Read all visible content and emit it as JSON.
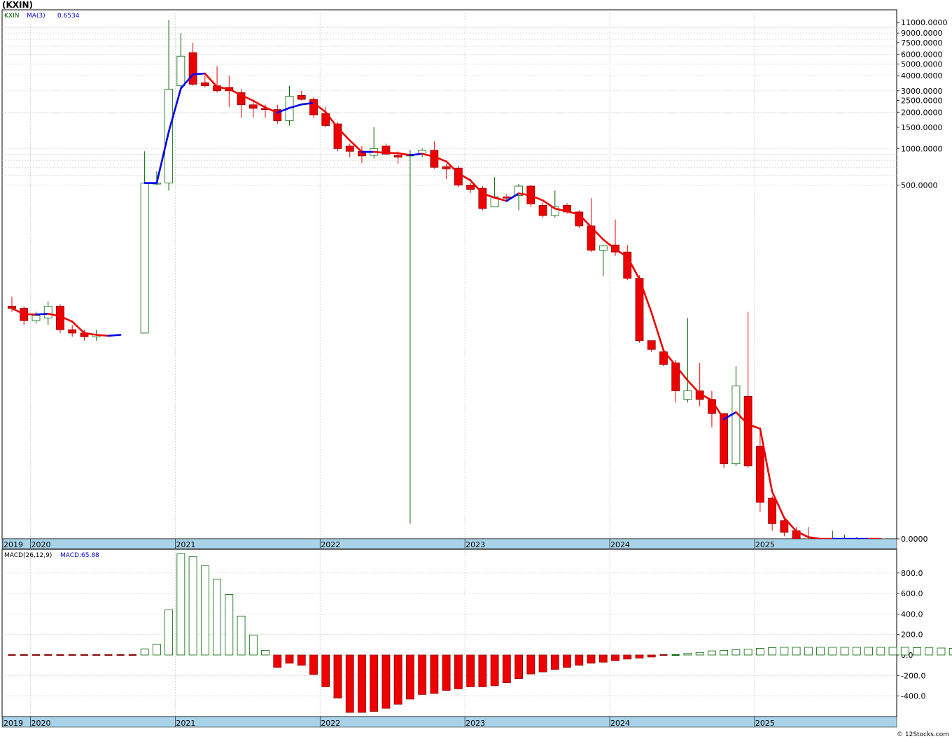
{
  "page": {
    "title": "(KXIN)",
    "footer": "© 12Stocks.com"
  },
  "colors": {
    "grid": "#c8c8c8",
    "axis_strip": "#a9d3e8",
    "up": "#006400",
    "down": "#ee0000",
    "ma_up": "#0000ee",
    "ma_down": "#ee0000"
  },
  "chart_data": [
    {
      "type": "candlestick",
      "panel": "price",
      "scale": "log",
      "legend": {
        "symbol": "KXIN",
        "ma_label": "MA(3)",
        "ma_value": "0.6534"
      },
      "y_tick_labels": [
        "11000.0000",
        "9000.0000",
        "7500.0000",
        "6000.0000",
        "5000.0000",
        "4000.0000",
        "3000.0000",
        "2500.0000",
        "2000.0000",
        "1500.0000",
        "1000.0000",
        "500.0000",
        "0.0000"
      ],
      "y_tick_values": [
        11000,
        9000,
        7500,
        6000,
        5000,
        4000,
        3000,
        2500,
        2000,
        1500,
        1000,
        500,
        0
      ],
      "x_labels": [
        "2019",
        "2020",
        "2021",
        "2022",
        "2023",
        "2024",
        "2025"
      ],
      "candles": [
        {
          "date": "2019-11",
          "o": 50,
          "h": 60,
          "l": 45,
          "c": 48
        },
        {
          "date": "2019-12",
          "o": 48,
          "h": 50,
          "l": 35,
          "c": 38
        },
        {
          "date": "2020-01",
          "o": 38,
          "h": 45,
          "l": 36,
          "c": 42
        },
        {
          "date": "2020-02",
          "o": 40,
          "h": 55,
          "l": 35,
          "c": 50
        },
        {
          "date": "2020-03",
          "o": 50,
          "h": 52,
          "l": 30,
          "c": 32
        },
        {
          "date": "2020-04",
          "o": 32,
          "h": 35,
          "l": 28,
          "c": 30
        },
        {
          "date": "2020-05",
          "o": 30,
          "h": 32,
          "l": 26,
          "c": 28
        },
        {
          "date": "2020-06",
          "o": 28,
          "h": 32,
          "l": 26,
          "c": 29
        },
        {
          "date": "2020-07",
          "o": null,
          "h": null,
          "l": null,
          "c": null
        },
        {
          "date": "2020-08",
          "o": null,
          "h": null,
          "l": null,
          "c": null
        },
        {
          "date": "2020-09",
          "o": null,
          "h": null,
          "l": null,
          "c": null
        },
        {
          "date": "2020-10",
          "o": 30,
          "h": 950,
          "l": 30,
          "c": 520
        },
        {
          "date": "2020-11",
          "o": 520,
          "h": 650,
          "l": 500,
          "c": 520
        },
        {
          "date": "2020-12",
          "o": 520,
          "h": 11500,
          "l": 450,
          "c": 3100
        },
        {
          "date": "2021-01",
          "o": 3300,
          "h": 9000,
          "l": 3100,
          "c": 5800
        },
        {
          "date": "2021-02",
          "o": 6200,
          "h": 7500,
          "l": 3300,
          "c": 3400
        },
        {
          "date": "2021-03",
          "o": 3500,
          "h": 4000,
          "l": 3200,
          "c": 3300
        },
        {
          "date": "2021-04",
          "o": 3300,
          "h": 4800,
          "l": 2900,
          "c": 3000
        },
        {
          "date": "2021-05",
          "o": 3200,
          "h": 4000,
          "l": 2200,
          "c": 3000
        },
        {
          "date": "2021-06",
          "o": 2900,
          "h": 3100,
          "l": 1800,
          "c": 2300
        },
        {
          "date": "2021-07",
          "o": 2300,
          "h": 2500,
          "l": 1800,
          "c": 2150
        },
        {
          "date": "2021-08",
          "o": 2150,
          "h": 2300,
          "l": 1800,
          "c": 2100
        },
        {
          "date": "2021-09",
          "o": 2100,
          "h": 2300,
          "l": 1600,
          "c": 1700
        },
        {
          "date": "2021-10",
          "o": 1700,
          "h": 3300,
          "l": 1550,
          "c": 2700
        },
        {
          "date": "2021-11",
          "o": 2750,
          "h": 3000,
          "l": 2500,
          "c": 2550
        },
        {
          "date": "2021-12",
          "o": 2550,
          "h": 2650,
          "l": 1800,
          "c": 1900
        },
        {
          "date": "2022-01",
          "o": 1950,
          "h": 2200,
          "l": 1500,
          "c": 1550
        },
        {
          "date": "2022-02",
          "o": 1600,
          "h": 1650,
          "l": 950,
          "c": 1000
        },
        {
          "date": "2022-03",
          "o": 1050,
          "h": 1100,
          "l": 850,
          "c": 950
        },
        {
          "date": "2022-04",
          "o": 950,
          "h": 1050,
          "l": 760,
          "c": 870
        },
        {
          "date": "2022-05",
          "o": 880,
          "h": 1500,
          "l": 830,
          "c": 1000
        },
        {
          "date": "2022-06",
          "o": 1050,
          "h": 1100,
          "l": 880,
          "c": 900
        },
        {
          "date": "2022-07",
          "o": 880,
          "h": 950,
          "l": 750,
          "c": 850
        },
        {
          "date": "2022-08",
          "o": 870,
          "h": 980,
          "l": 0.8,
          "c": 900
        },
        {
          "date": "2022-09",
          "o": 900,
          "h": 1000,
          "l": 850,
          "c": 970
        },
        {
          "date": "2022-10",
          "o": 970,
          "h": 1150,
          "l": 680,
          "c": 700
        },
        {
          "date": "2022-11",
          "o": 710,
          "h": 750,
          "l": 560,
          "c": 680
        },
        {
          "date": "2022-12",
          "o": 690,
          "h": 720,
          "l": 480,
          "c": 500
        },
        {
          "date": "2023-01",
          "o": 500,
          "h": 520,
          "l": 430,
          "c": 460
        },
        {
          "date": "2023-02",
          "o": 470,
          "h": 490,
          "l": 310,
          "c": 320
        },
        {
          "date": "2023-03",
          "o": 330,
          "h": 580,
          "l": 330,
          "c": 400
        },
        {
          "date": "2023-04",
          "o": 400,
          "h": 420,
          "l": 370,
          "c": 390
        },
        {
          "date": "2023-05",
          "o": 410,
          "h": 510,
          "l": 310,
          "c": 490
        },
        {
          "date": "2023-06",
          "o": 490,
          "h": 500,
          "l": 330,
          "c": 350
        },
        {
          "date": "2023-07",
          "o": 340,
          "h": 360,
          "l": 270,
          "c": 280
        },
        {
          "date": "2023-08",
          "o": 280,
          "h": 450,
          "l": 270,
          "c": 330
        },
        {
          "date": "2023-09",
          "o": 340,
          "h": 355,
          "l": 290,
          "c": 300
        },
        {
          "date": "2023-10",
          "o": 300,
          "h": 310,
          "l": 220,
          "c": 230
        },
        {
          "date": "2023-11",
          "o": 230,
          "h": 390,
          "l": 140,
          "c": 145
        },
        {
          "date": "2023-12",
          "o": 145,
          "h": 160,
          "l": 88,
          "c": 158
        },
        {
          "date": "2024-01",
          "o": 160,
          "h": 260,
          "l": 130,
          "c": 140
        },
        {
          "date": "2024-02",
          "o": 140,
          "h": 160,
          "l": 82,
          "c": 85
        },
        {
          "date": "2024-03",
          "o": 85,
          "h": 90,
          "l": 25,
          "c": 26
        },
        {
          "date": "2024-04",
          "o": 26,
          "h": 26,
          "l": 21,
          "c": 22
        },
        {
          "date": "2024-05",
          "o": 21,
          "h": 22,
          "l": 16,
          "c": 16.5
        },
        {
          "date": "2024-06",
          "o": 17,
          "h": 18,
          "l": 8,
          "c": 10
        },
        {
          "date": "2024-07",
          "o": 8.5,
          "h": 40,
          "l": 8,
          "c": 10
        },
        {
          "date": "2024-08",
          "o": 10,
          "h": 17,
          "l": 7.5,
          "c": 8.5
        },
        {
          "date": "2024-09",
          "o": 8.5,
          "h": 10,
          "l": 5,
          "c": 6.5
        },
        {
          "date": "2024-10",
          "o": 6.5,
          "h": 6.5,
          "l": 2.3,
          "c": 2.5
        },
        {
          "date": "2024-11",
          "o": 2.5,
          "h": 16,
          "l": 2.4,
          "c": 11
        },
        {
          "date": "2024-12",
          "o": 9,
          "h": 45,
          "l": 2.3,
          "c": 2.4
        },
        {
          "date": "2025-01",
          "o": 3.5,
          "h": 5,
          "l": 1,
          "c": 1.2
        },
        {
          "date": "2025-02",
          "o": 1.3,
          "h": 1.35,
          "l": 0.7,
          "c": 0.8
        },
        {
          "date": "2025-03",
          "o": 0.85,
          "h": 0.9,
          "l": 0.63,
          "c": 0.68
        },
        {
          "date": "2025-04",
          "o": 0.7,
          "h": 0.75,
          "l": 0.58,
          "c": 0.6
        },
        {
          "date": "2025-05",
          "o": 0.6,
          "h": 0.75,
          "l": 0.55,
          "c": 0.58
        },
        {
          "date": "2025-06",
          "o": 0.58,
          "h": 0.6,
          "l": 0.54,
          "c": 0.56
        },
        {
          "date": "2025-07",
          "o": 0.56,
          "h": 0.7,
          "l": 0.54,
          "c": 0.57
        },
        {
          "date": "2025-08",
          "o": 0.58,
          "h": 0.65,
          "l": 0.55,
          "c": 0.6
        },
        {
          "date": "2025-09",
          "o": 0.6,
          "h": 0.62,
          "l": 0.52,
          "c": 0.58
        },
        {
          "date": "2025-10",
          "o": 0.58,
          "h": 0.6,
          "l": 0.55,
          "c": 0.57
        },
        {
          "date": "2025-11",
          "o": 0.56,
          "h": 0.6,
          "l": 0.55,
          "c": 0.57
        }
      ]
    },
    {
      "type": "bar",
      "panel": "macd",
      "legend": {
        "label": "MACD(26,12,9)",
        "value_label": "MACD:65.88"
      },
      "y_tick_labels": [
        "800.0",
        "600.0",
        "400.0",
        "200.0",
        "0.0",
        "-200.0",
        "-400.0"
      ],
      "y_tick_values": [
        800,
        600,
        400,
        200,
        0,
        -200,
        -400
      ],
      "ylim": [
        -560,
        990
      ],
      "x_labels": [
        "2019",
        "2020",
        "2021",
        "2022",
        "2023",
        "2024",
        "2025"
      ],
      "values": [
        -5,
        -5,
        -5,
        -5,
        -4,
        -4,
        -4,
        -4,
        -4,
        -4,
        -4,
        60,
        105,
        440,
        990,
        960,
        870,
        740,
        590,
        380,
        195,
        45,
        -120,
        -80,
        -100,
        -190,
        -310,
        -420,
        -560,
        -560,
        -550,
        -520,
        -480,
        -430,
        -385,
        -375,
        -345,
        -330,
        -310,
        -310,
        -300,
        -270,
        -230,
        -185,
        -165,
        -140,
        -120,
        -100,
        -80,
        -70,
        -55,
        -40,
        -30,
        -20,
        -10,
        5,
        15,
        25,
        40,
        45,
        52,
        58,
        65,
        72,
        75,
        75,
        75,
        75,
        75,
        75,
        75,
        75,
        75,
        75,
        75,
        72,
        70,
        68,
        65
      ]
    }
  ]
}
